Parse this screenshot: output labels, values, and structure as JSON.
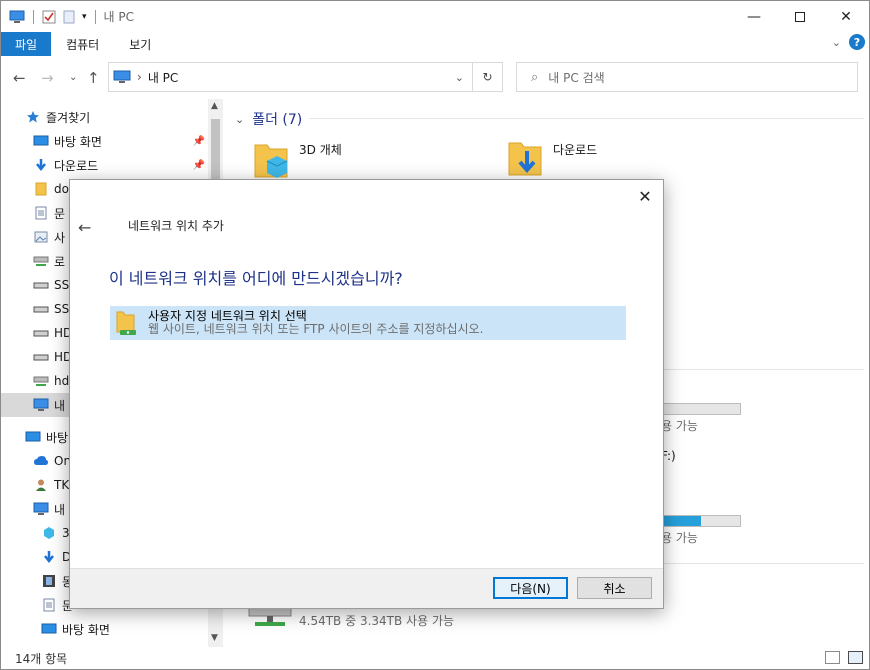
{
  "window": {
    "title": "내 PC"
  },
  "ribbon": {
    "tabs": [
      "파일",
      "컴퓨터",
      "보기"
    ]
  },
  "address": {
    "path": "내 PC",
    "search_placeholder": "내 PC 검색"
  },
  "sidebar": {
    "items": [
      {
        "label": "즐겨찾기",
        "icon": "star-icon"
      },
      {
        "label": "바탕 화면",
        "icon": "desktop-icon",
        "pinned": true
      },
      {
        "label": "다운로드",
        "icon": "download-icon",
        "pinned": true
      },
      {
        "label": "do",
        "icon": "folder-icon"
      },
      {
        "label": "문",
        "icon": "document-icon"
      },
      {
        "label": "사",
        "icon": "picture-icon"
      },
      {
        "label": "로",
        "icon": "network-drive-icon"
      },
      {
        "label": "SS",
        "icon": "drive-icon"
      },
      {
        "label": "SS",
        "icon": "drive-icon"
      },
      {
        "label": "HD",
        "icon": "drive-icon"
      },
      {
        "label": "HD",
        "icon": "drive-icon"
      },
      {
        "label": "hd",
        "icon": "network-drive-icon"
      },
      {
        "label": "내",
        "icon": "pc-icon",
        "selected": true
      },
      {
        "label": "바탕",
        "icon": "desktop-icon"
      },
      {
        "label": "On",
        "icon": "cloud-icon"
      },
      {
        "label": "TK",
        "icon": "user-icon"
      },
      {
        "label": "내",
        "icon": "pc-icon"
      },
      {
        "label": "3",
        "icon": "cube-icon"
      },
      {
        "label": "D",
        "icon": "download-icon"
      },
      {
        "label": "동",
        "icon": "video-icon"
      },
      {
        "label": "문",
        "icon": "document-icon"
      },
      {
        "label": "바탕 화면",
        "icon": "desktop-icon"
      }
    ]
  },
  "main": {
    "group_label": "폴더 (7)",
    "folders": [
      {
        "label": "3D 개체",
        "icon": "cube-icon"
      },
      {
        "label": "다운로드",
        "icon": "download-icon"
      }
    ],
    "drives": [
      {
        "usage_text": "용 가능",
        "used_fraction": 0.0
      },
      {
        "usage_text": "용 가능",
        "used_fraction": 0.5
      }
    ],
    "drive_letter_fragment": "F:)",
    "bottom_drive_usage": "4.54TB 중 3.34TB 사용 가능"
  },
  "status": {
    "count": "14개 항목"
  },
  "dialog": {
    "title": "네트워크 위치 추가",
    "heading": "이 네트워크 위치를 어디에 만드시겠습니까?",
    "option": {
      "title": "사용자 지정 네트워크 위치 선택",
      "description": "웹 사이트, 네트워크 위치 또는 FTP 사이트의 주소를 지정하십시오."
    },
    "next_label": "다음(N)",
    "cancel_label": "취소"
  },
  "colors": {
    "accent": "#1979ca",
    "heading": "#1e3287",
    "selection": "#cce4f7"
  }
}
